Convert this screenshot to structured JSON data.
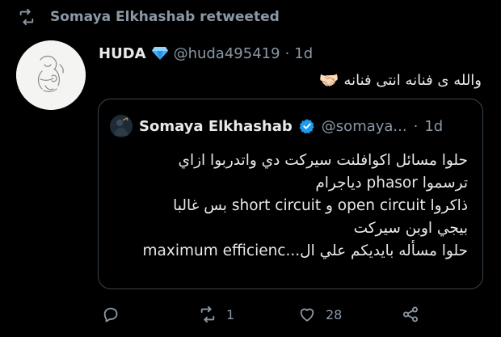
{
  "retweet_banner": {
    "icon": "retweet-icon",
    "text": "Somaya Elkhashab retweeted"
  },
  "tweet": {
    "author_name": "HUDA",
    "author_badge_icon": "blue-diamond-icon",
    "handle": "@huda495419",
    "separator": "·",
    "time": "1d",
    "text": "والله ى فنانه انتى فنانه",
    "emoji": "🤝🏻"
  },
  "quote": {
    "author_name": "Somaya Elkhashab",
    "verified_icon": "verified-badge-icon",
    "handle": "@somaya...",
    "separator": "·",
    "time": "1d",
    "lines": [
      "حلوا مسائل اكوافلنت سيركت دي واتدربوا ازاي",
      "ترسموا phasor دياجرام",
      "ذاكروا open circuit و short circuit بس غالبا",
      "بيجي اوبن سيركت",
      "حلوا مسأله بايديكم علي ال...maximum efficienc"
    ]
  },
  "actions": {
    "reply_icon": "reply-icon",
    "retweet_icon": "retweet-icon",
    "retweet_count": "1",
    "like_icon": "heart-icon",
    "like_count": "28",
    "share_icon": "share-icon"
  },
  "colors": {
    "background": "#000000",
    "text_primary": "#e7e9ea",
    "text_secondary": "#8b98a5",
    "border": "#38444d",
    "verified_blue": "#1d9bf0"
  }
}
